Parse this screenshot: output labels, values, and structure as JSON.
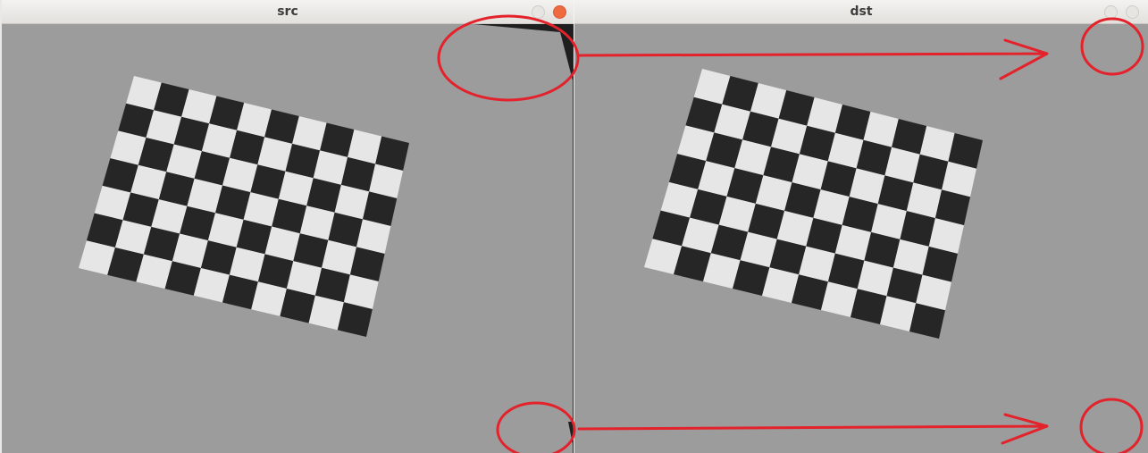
{
  "windows": [
    {
      "title": "src"
    },
    {
      "title": "dst"
    }
  ],
  "checkerboard": {
    "rows": 7,
    "cols": 10,
    "dark_color": "#262626",
    "light_color": "#e6e6e6"
  },
  "colors": {
    "canvas_bg": "#9c9c9c",
    "annotation": "#e3222b",
    "corner_fill": "#1f1f1f"
  },
  "icons": {
    "close": "close-icon",
    "minimize": "minimize-icon",
    "maximize": "maximize-icon"
  }
}
